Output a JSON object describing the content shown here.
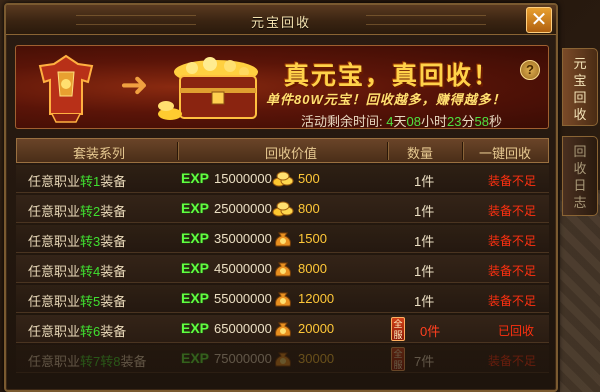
{
  "window": {
    "title": "元宝回收"
  },
  "banner": {
    "slogan": "真元宝，真回收！",
    "subline": "单件80W元宝！回收越多，赚得越多！",
    "countdown": {
      "label": "活动剩余时间:",
      "days": "4",
      "days_unit": "天",
      "hours": "08",
      "hours_unit": "小时",
      "minutes": "23",
      "minutes_unit": "分",
      "seconds": "58",
      "seconds_unit": "秒"
    },
    "help": "?"
  },
  "table": {
    "headers": {
      "series": "套装系列",
      "value": "回收价值",
      "qty": "数量",
      "action": "一键回收"
    },
    "exp_label": "EXP",
    "rows": [
      {
        "prefix": "任意职业",
        "tier": "转1",
        "suffix": "装备",
        "exp": "15000000",
        "coins": "500",
        "coin_icon": "gold-ingots",
        "qty": "1件",
        "status": "装备不足"
      },
      {
        "prefix": "任意职业",
        "tier": "转2",
        "suffix": "装备",
        "exp": "25000000",
        "coins": "800",
        "coin_icon": "gold-ingots",
        "qty": "1件",
        "status": "装备不足"
      },
      {
        "prefix": "任意职业",
        "tier": "转3",
        "suffix": "装备",
        "exp": "35000000",
        "coins": "1500",
        "coin_icon": "gold-bag",
        "qty": "1件",
        "status": "装备不足"
      },
      {
        "prefix": "任意职业",
        "tier": "转4",
        "suffix": "装备",
        "exp": "45000000",
        "coins": "8000",
        "coin_icon": "gold-bag",
        "qty": "1件",
        "status": "装备不足"
      },
      {
        "prefix": "任意职业",
        "tier": "转5",
        "suffix": "装备",
        "exp": "55000000",
        "coins": "12000",
        "coin_icon": "gold-bag",
        "qty": "1件",
        "status": "装备不足"
      },
      {
        "prefix": "任意职业",
        "tier": "转6",
        "suffix": "装备",
        "exp": "65000000",
        "coins": "20000",
        "coin_icon": "gold-bag",
        "qty": "0件",
        "status": "已回收",
        "badge": "全服"
      },
      {
        "prefix": "任意职业",
        "tier": "转7转8",
        "suffix": "装备",
        "exp": "75000000",
        "coins": "30000",
        "coin_icon": "gold-bag",
        "qty": "7件",
        "status": "装备不足",
        "badge": "全服"
      }
    ]
  },
  "side_tabs": [
    {
      "label": "元宝回收",
      "active": true
    },
    {
      "label": "回收日志",
      "active": false
    }
  ],
  "colors": {
    "accent_gold": "#ffd24a",
    "status_red": "#ff3010",
    "exp_green": "#60ff40",
    "tier_green": "#40e030"
  }
}
